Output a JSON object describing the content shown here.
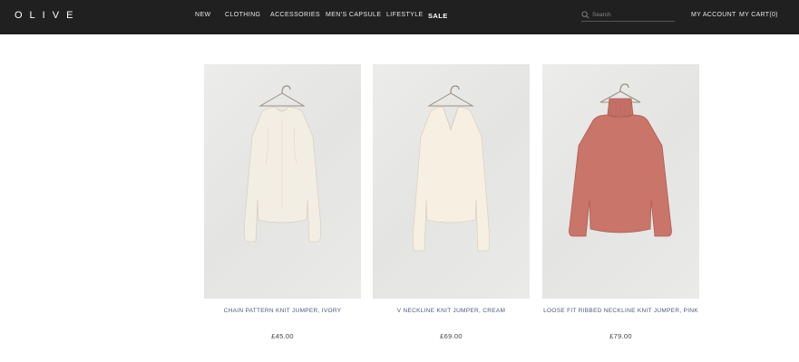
{
  "header": {
    "logo": "OLIVE",
    "nav": [
      {
        "label": "NEW"
      },
      {
        "label": "CLOTHING"
      },
      {
        "label": "ACCESSORIES"
      },
      {
        "label": "MEN'S CAPSULE"
      },
      {
        "label": "LIFESTYLE"
      },
      {
        "label": "SALE"
      }
    ],
    "search": {
      "placeholder": "Search",
      "value": ""
    },
    "account_label": "MY ACCOUNT",
    "cart_label": "MY CART(0)"
  },
  "products": [
    {
      "name": "CHAIN PATTERN KNIT JUMPER, IVORY",
      "price": "£45.00",
      "color": "#f3eee4",
      "style": "crew"
    },
    {
      "name": "V NECKLINE KNIT JUMPER, CREAM",
      "price": "£69.00",
      "color": "#f6efe2",
      "style": "vneck"
    },
    {
      "name": "LOOSE FIT RIBBED NECKLINE KNIT JUMPER, PINK",
      "price": "£79.00",
      "color": "#c9756a",
      "style": "turtle"
    }
  ]
}
